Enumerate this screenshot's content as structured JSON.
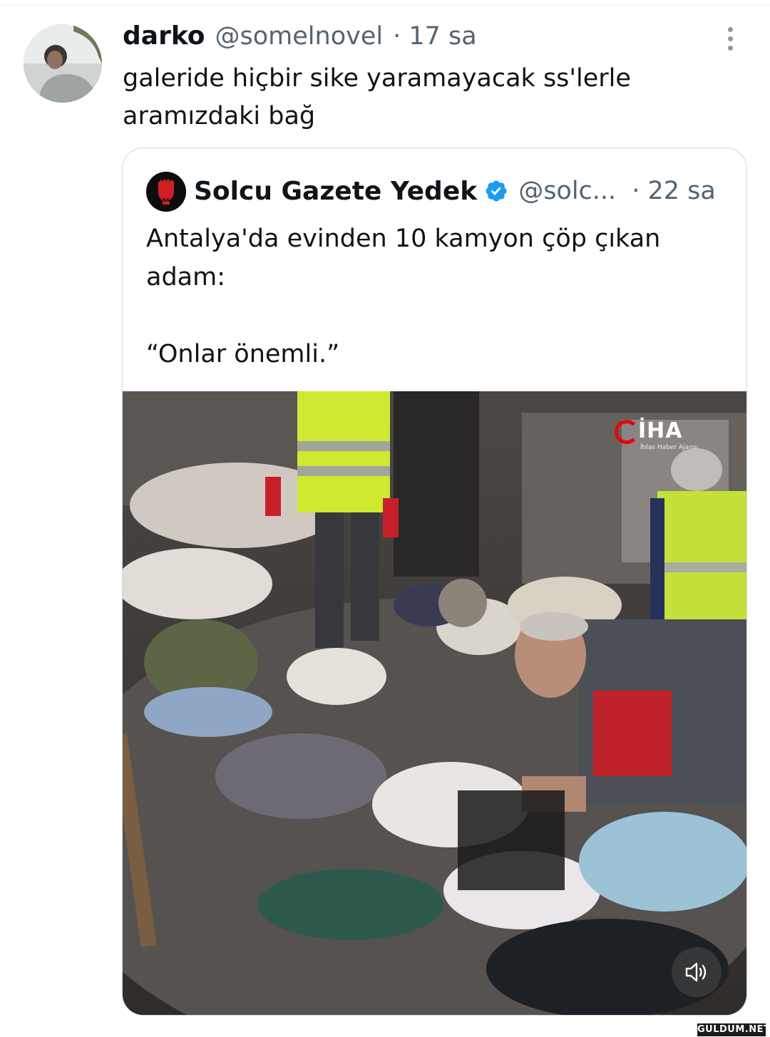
{
  "tweet": {
    "author_name": "darko",
    "author_handle": "@somelnovel",
    "time": "· 17 sa",
    "text": "galeride hiçbir sike yaramayacak ss'lerle aramızdaki bağ",
    "avatar_icon": "profile-photo"
  },
  "quoted_tweet": {
    "author_name": "Solcu Gazete Yedek",
    "author_handle": "@solc...",
    "time": "· 22 sa",
    "verified_icon": "verified-badge-icon",
    "verified_color": "#1d9bf0",
    "text": "Antalya'da evinden 10 kamyon çöp çıkan adam:\n\n“Onlar önemli.”",
    "avatar_badge": "SG",
    "media": {
      "logo_text": "İHA",
      "logo_subtext": "İhlas Haber Ajansı",
      "sound_icon": "speaker-icon"
    }
  },
  "watermark": "GULDUM.NET",
  "colors": {
    "text": "#0f1419",
    "secondary_text": "#536471",
    "border": "#cfd9de",
    "iha_red": "#e30613"
  }
}
